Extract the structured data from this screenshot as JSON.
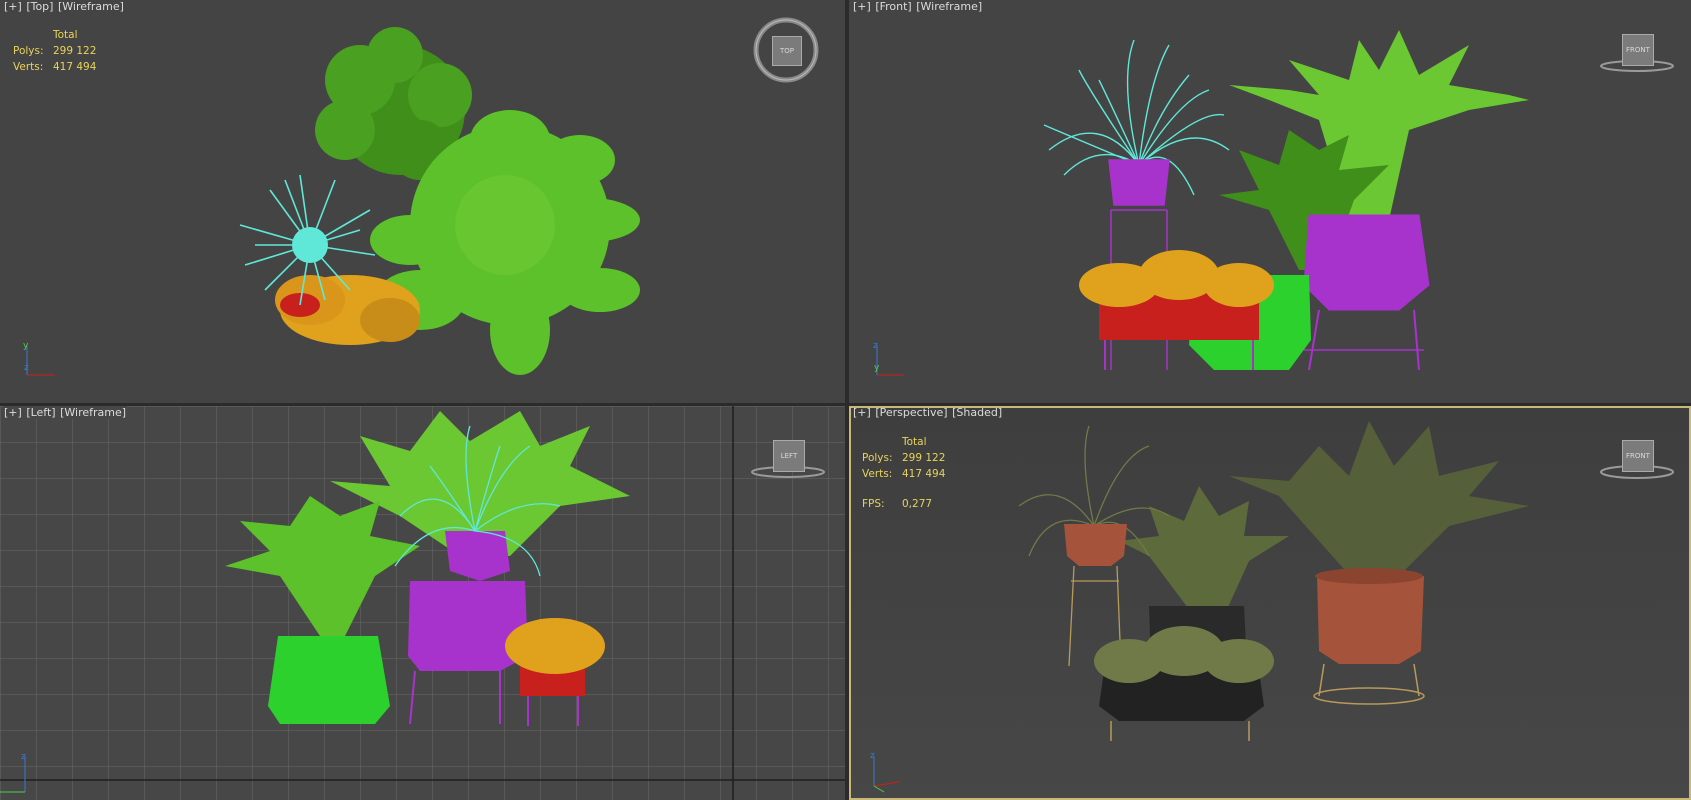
{
  "viewports": {
    "top": {
      "plus": "[+]",
      "name": "[Top]",
      "mode": "[Wireframe]",
      "stats": {
        "header": "Total",
        "polys_label": "Polys:",
        "polys": "299 122",
        "verts_label": "Verts:",
        "verts": "417 494"
      },
      "cube": "TOP"
    },
    "front": {
      "plus": "[+]",
      "name": "[Front]",
      "mode": "[Wireframe]",
      "cube": "FRONT"
    },
    "left": {
      "plus": "[+]",
      "name": "[Left]",
      "mode": "[Wireframe]",
      "cube": "LEFT"
    },
    "perspective": {
      "plus": "[+]",
      "name": "[Perspective]",
      "mode": "[Shaded]",
      "stats": {
        "header": "Total",
        "polys_label": "Polys:",
        "polys": "299 122",
        "verts_label": "Verts:",
        "verts": "417 494",
        "fps_label": "FPS:",
        "fps": "0,277"
      },
      "cube": "FRONT"
    }
  },
  "axes": {
    "x": "x",
    "y": "y",
    "z": "z"
  },
  "colors": {
    "bg": "#444444",
    "stats": "#e8d35a",
    "active_border": "#c9b877",
    "cyan": "#5fe8d8",
    "green": "#5cc12a",
    "dark_green": "#3f8f1a",
    "magenta": "#a733cc",
    "orange": "#e0a21c",
    "red": "#c8201c",
    "bright_green": "#2dd12d",
    "terracotta": "#a5533a",
    "charcoal": "#2a2a2a"
  }
}
